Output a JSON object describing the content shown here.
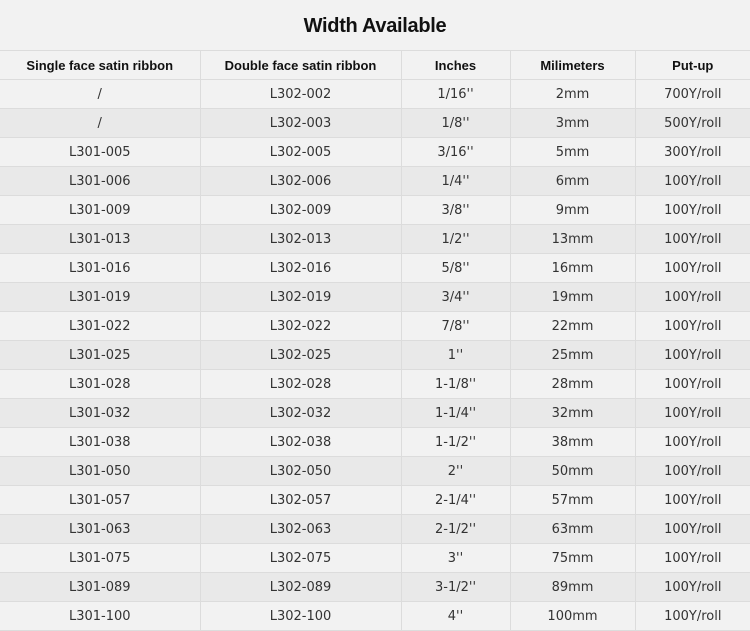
{
  "title": "Width Available",
  "headers": [
    "Single face satin ribbon",
    "Double face satin ribbon",
    "Inches",
    "Milimeters",
    "Put-up"
  ],
  "rows": [
    [
      "/",
      "L302-002",
      "1/16''",
      "2mm",
      "700Y/roll"
    ],
    [
      "/",
      "L302-003",
      "1/8''",
      "3mm",
      "500Y/roll"
    ],
    [
      "L301-005",
      "L302-005",
      "3/16''",
      "5mm",
      "300Y/roll"
    ],
    [
      "L301-006",
      "L302-006",
      "1/4''",
      "6mm",
      "100Y/roll"
    ],
    [
      "L301-009",
      "L302-009",
      "3/8''",
      "9mm",
      "100Y/roll"
    ],
    [
      "L301-013",
      "L302-013",
      "1/2''",
      "13mm",
      "100Y/roll"
    ],
    [
      "L301-016",
      "L302-016",
      "5/8''",
      "16mm",
      "100Y/roll"
    ],
    [
      "L301-019",
      "L302-019",
      "3/4''",
      "19mm",
      "100Y/roll"
    ],
    [
      "L301-022",
      "L302-022",
      "7/8''",
      "22mm",
      "100Y/roll"
    ],
    [
      "L301-025",
      "L302-025",
      "1''",
      "25mm",
      "100Y/roll"
    ],
    [
      "L301-028",
      "L302-028",
      "1-1/8''",
      "28mm",
      "100Y/roll"
    ],
    [
      "L301-032",
      "L302-032",
      "1-1/4''",
      "32mm",
      "100Y/roll"
    ],
    [
      "L301-038",
      "L302-038",
      "1-1/2''",
      "38mm",
      "100Y/roll"
    ],
    [
      "L301-050",
      "L302-050",
      "2''",
      "50mm",
      "100Y/roll"
    ],
    [
      "L301-057",
      "L302-057",
      "2-1/4''",
      "57mm",
      "100Y/roll"
    ],
    [
      "L301-063",
      "L302-063",
      "2-1/2''",
      "63mm",
      "100Y/roll"
    ],
    [
      "L301-075",
      "L302-075",
      "3''",
      "75mm",
      "100Y/roll"
    ],
    [
      "L301-089",
      "L302-089",
      "3-1/2''",
      "89mm",
      "100Y/roll"
    ],
    [
      "L301-100",
      "L302-100",
      "4''",
      "100mm",
      "100Y/roll"
    ]
  ]
}
